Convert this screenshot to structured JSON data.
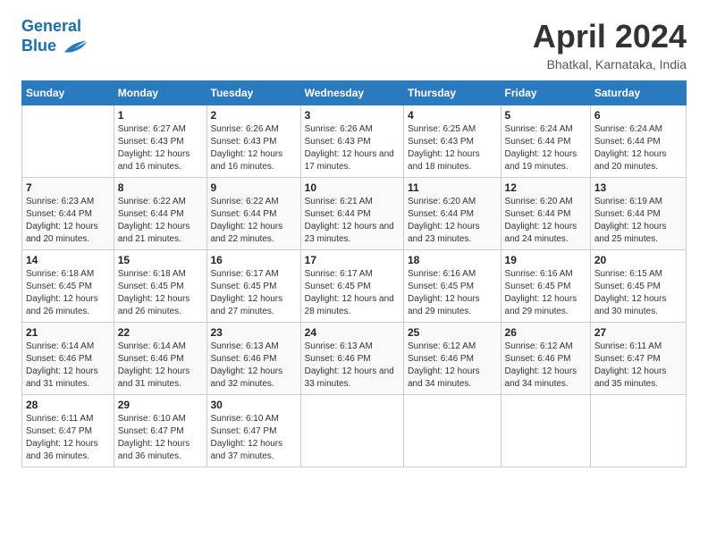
{
  "header": {
    "logo_line1": "General",
    "logo_line2": "Blue",
    "title": "April 2024",
    "subtitle": "Bhatkal, Karnataka, India"
  },
  "columns": [
    "Sunday",
    "Monday",
    "Tuesday",
    "Wednesday",
    "Thursday",
    "Friday",
    "Saturday"
  ],
  "weeks": [
    [
      {
        "day": "",
        "sunrise": "",
        "sunset": "",
        "daylight": ""
      },
      {
        "day": "1",
        "sunrise": "Sunrise: 6:27 AM",
        "sunset": "Sunset: 6:43 PM",
        "daylight": "Daylight: 12 hours and 16 minutes."
      },
      {
        "day": "2",
        "sunrise": "Sunrise: 6:26 AM",
        "sunset": "Sunset: 6:43 PM",
        "daylight": "Daylight: 12 hours and 16 minutes."
      },
      {
        "day": "3",
        "sunrise": "Sunrise: 6:26 AM",
        "sunset": "Sunset: 6:43 PM",
        "daylight": "Daylight: 12 hours and 17 minutes."
      },
      {
        "day": "4",
        "sunrise": "Sunrise: 6:25 AM",
        "sunset": "Sunset: 6:43 PM",
        "daylight": "Daylight: 12 hours and 18 minutes."
      },
      {
        "day": "5",
        "sunrise": "Sunrise: 6:24 AM",
        "sunset": "Sunset: 6:44 PM",
        "daylight": "Daylight: 12 hours and 19 minutes."
      },
      {
        "day": "6",
        "sunrise": "Sunrise: 6:24 AM",
        "sunset": "Sunset: 6:44 PM",
        "daylight": "Daylight: 12 hours and 20 minutes."
      }
    ],
    [
      {
        "day": "7",
        "sunrise": "Sunrise: 6:23 AM",
        "sunset": "Sunset: 6:44 PM",
        "daylight": "Daylight: 12 hours and 20 minutes."
      },
      {
        "day": "8",
        "sunrise": "Sunrise: 6:22 AM",
        "sunset": "Sunset: 6:44 PM",
        "daylight": "Daylight: 12 hours and 21 minutes."
      },
      {
        "day": "9",
        "sunrise": "Sunrise: 6:22 AM",
        "sunset": "Sunset: 6:44 PM",
        "daylight": "Daylight: 12 hours and 22 minutes."
      },
      {
        "day": "10",
        "sunrise": "Sunrise: 6:21 AM",
        "sunset": "Sunset: 6:44 PM",
        "daylight": "Daylight: 12 hours and 23 minutes."
      },
      {
        "day": "11",
        "sunrise": "Sunrise: 6:20 AM",
        "sunset": "Sunset: 6:44 PM",
        "daylight": "Daylight: 12 hours and 23 minutes."
      },
      {
        "day": "12",
        "sunrise": "Sunrise: 6:20 AM",
        "sunset": "Sunset: 6:44 PM",
        "daylight": "Daylight: 12 hours and 24 minutes."
      },
      {
        "day": "13",
        "sunrise": "Sunrise: 6:19 AM",
        "sunset": "Sunset: 6:44 PM",
        "daylight": "Daylight: 12 hours and 25 minutes."
      }
    ],
    [
      {
        "day": "14",
        "sunrise": "Sunrise: 6:18 AM",
        "sunset": "Sunset: 6:45 PM",
        "daylight": "Daylight: 12 hours and 26 minutes."
      },
      {
        "day": "15",
        "sunrise": "Sunrise: 6:18 AM",
        "sunset": "Sunset: 6:45 PM",
        "daylight": "Daylight: 12 hours and 26 minutes."
      },
      {
        "day": "16",
        "sunrise": "Sunrise: 6:17 AM",
        "sunset": "Sunset: 6:45 PM",
        "daylight": "Daylight: 12 hours and 27 minutes."
      },
      {
        "day": "17",
        "sunrise": "Sunrise: 6:17 AM",
        "sunset": "Sunset: 6:45 PM",
        "daylight": "Daylight: 12 hours and 28 minutes."
      },
      {
        "day": "18",
        "sunrise": "Sunrise: 6:16 AM",
        "sunset": "Sunset: 6:45 PM",
        "daylight": "Daylight: 12 hours and 29 minutes."
      },
      {
        "day": "19",
        "sunrise": "Sunrise: 6:16 AM",
        "sunset": "Sunset: 6:45 PM",
        "daylight": "Daylight: 12 hours and 29 minutes."
      },
      {
        "day": "20",
        "sunrise": "Sunrise: 6:15 AM",
        "sunset": "Sunset: 6:45 PM",
        "daylight": "Daylight: 12 hours and 30 minutes."
      }
    ],
    [
      {
        "day": "21",
        "sunrise": "Sunrise: 6:14 AM",
        "sunset": "Sunset: 6:46 PM",
        "daylight": "Daylight: 12 hours and 31 minutes."
      },
      {
        "day": "22",
        "sunrise": "Sunrise: 6:14 AM",
        "sunset": "Sunset: 6:46 PM",
        "daylight": "Daylight: 12 hours and 31 minutes."
      },
      {
        "day": "23",
        "sunrise": "Sunrise: 6:13 AM",
        "sunset": "Sunset: 6:46 PM",
        "daylight": "Daylight: 12 hours and 32 minutes."
      },
      {
        "day": "24",
        "sunrise": "Sunrise: 6:13 AM",
        "sunset": "Sunset: 6:46 PM",
        "daylight": "Daylight: 12 hours and 33 minutes."
      },
      {
        "day": "25",
        "sunrise": "Sunrise: 6:12 AM",
        "sunset": "Sunset: 6:46 PM",
        "daylight": "Daylight: 12 hours and 34 minutes."
      },
      {
        "day": "26",
        "sunrise": "Sunrise: 6:12 AM",
        "sunset": "Sunset: 6:46 PM",
        "daylight": "Daylight: 12 hours and 34 minutes."
      },
      {
        "day": "27",
        "sunrise": "Sunrise: 6:11 AM",
        "sunset": "Sunset: 6:47 PM",
        "daylight": "Daylight: 12 hours and 35 minutes."
      }
    ],
    [
      {
        "day": "28",
        "sunrise": "Sunrise: 6:11 AM",
        "sunset": "Sunset: 6:47 PM",
        "daylight": "Daylight: 12 hours and 36 minutes."
      },
      {
        "day": "29",
        "sunrise": "Sunrise: 6:10 AM",
        "sunset": "Sunset: 6:47 PM",
        "daylight": "Daylight: 12 hours and 36 minutes."
      },
      {
        "day": "30",
        "sunrise": "Sunrise: 6:10 AM",
        "sunset": "Sunset: 6:47 PM",
        "daylight": "Daylight: 12 hours and 37 minutes."
      },
      {
        "day": "",
        "sunrise": "",
        "sunset": "",
        "daylight": ""
      },
      {
        "day": "",
        "sunrise": "",
        "sunset": "",
        "daylight": ""
      },
      {
        "day": "",
        "sunrise": "",
        "sunset": "",
        "daylight": ""
      },
      {
        "day": "",
        "sunrise": "",
        "sunset": "",
        "daylight": ""
      }
    ]
  ]
}
